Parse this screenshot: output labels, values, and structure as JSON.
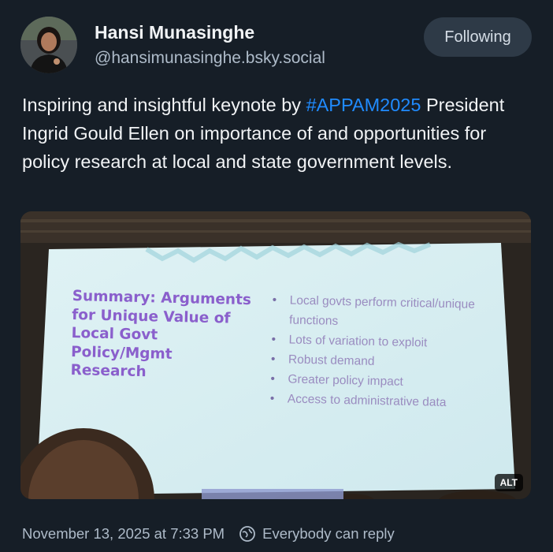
{
  "author": {
    "display_name": "Hansi Munasinghe",
    "handle": "@hansimunasinghe.bsky.social",
    "avatar_icon": "profile-photo"
  },
  "follow_button": {
    "label": "Following"
  },
  "post": {
    "text_before": "Inspiring and insightful keynote by ",
    "hashtag": "#APPAM2025",
    "text_after": " President Ingrid Gould Ellen on importance of and opportunities for policy research at local and state government levels."
  },
  "image": {
    "alt_label": "ALT",
    "slide": {
      "title": "Summary: Arguments for Unique Value of Local Govt Policy/Mgmt Research",
      "bullets": [
        "Local govts perform critical/unique functions",
        "Lots of variation to exploit",
        "Robust demand",
        "Greater policy impact",
        "Access to administrative data"
      ]
    }
  },
  "footer": {
    "timestamp": "November 13, 2025 at 7:33 PM",
    "reply_setting": "Everybody can reply",
    "reply_icon": "globe-icon"
  },
  "colors": {
    "background": "#161e27",
    "hashtag": "#208bfe",
    "secondary_text": "#aebbc9",
    "button_bg": "#2e3a47",
    "slide_title": "#8a5fcc"
  }
}
